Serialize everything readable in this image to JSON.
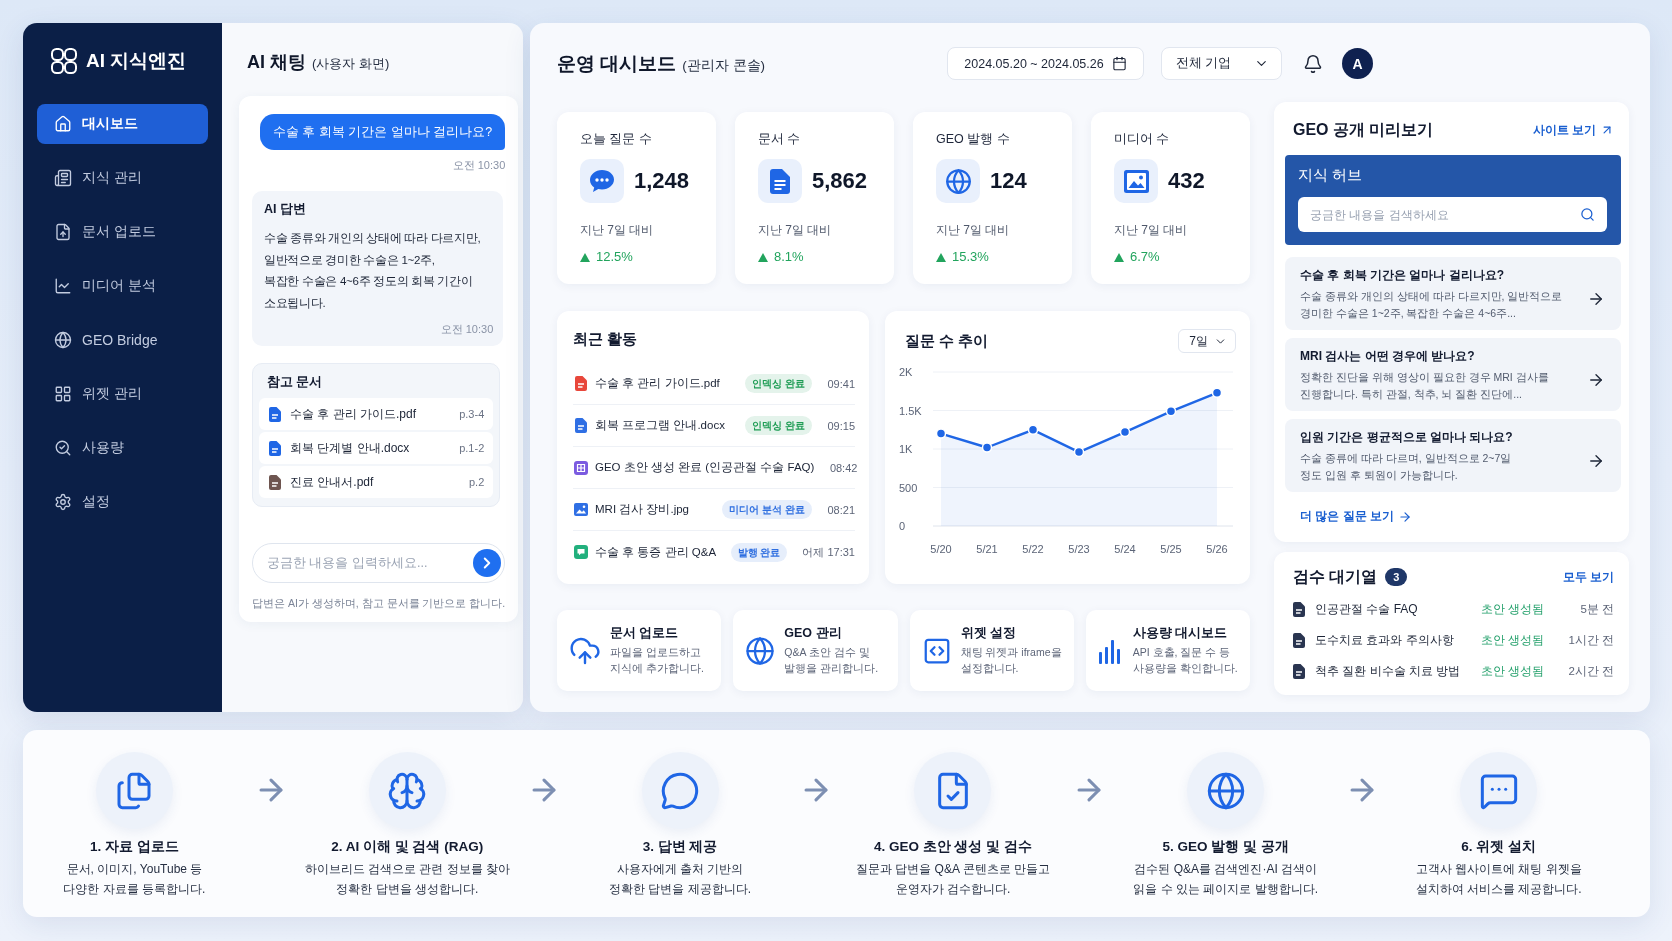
{
  "sidebar": {
    "logo": "AI 지식엔진",
    "items": [
      {
        "label": "대시보드",
        "selected": true
      },
      {
        "label": "지식 관리",
        "selected": false
      },
      {
        "label": "문서 업로드",
        "selected": false
      },
      {
        "label": "미디어 분석",
        "selected": false
      },
      {
        "label": "GEO Bridge",
        "selected": false
      },
      {
        "label": "위젯 관리",
        "selected": false
      },
      {
        "label": "사용량",
        "selected": false
      },
      {
        "label": "설정",
        "selected": false
      }
    ]
  },
  "chat": {
    "title": "AI 채팅",
    "subtitle": "(사용자 화면)",
    "user_message": {
      "text": "수술 후 회복 기간은 얼마나 걸리나요?",
      "time": "오전 10:30"
    },
    "ai_answer": {
      "heading": "AI 답변",
      "text": "수술 종류와 개인의 상태에 따라 다르지만,\n일반적으로 경미한 수술은 1~2주,\n복잡한 수술은 4~6주 정도의 회복 기간이\n소요됩니다.",
      "time": "오전 10:30"
    },
    "references": {
      "heading": "참고 문서",
      "items": [
        {
          "name": "수술 후 관리 가이드.pdf",
          "pages": "p.3-4",
          "color": "#1f66e5"
        },
        {
          "name": "회복 단계별 안내.docx",
          "pages": "p.1-2",
          "color": "#1f66e5"
        },
        {
          "name": "진료 안내서.pdf",
          "pages": "p.2",
          "color": "#6e5550"
        }
      ]
    },
    "input": {
      "placeholder": "궁금한 내용을 입력하세요..."
    },
    "footnote": "답변은 AI가 생성하며, 참고 문서를 기반으로 합니다."
  },
  "dashboard": {
    "title": "운영 대시보드",
    "subtitle": "(관리자 콘솔)",
    "date_range": "2024.05.20 ~ 2024.05.26",
    "company_filter": "전체 기업",
    "avatar": "A",
    "stats": [
      {
        "label": "오늘 질문 수",
        "value": "1,248",
        "caption": "지난 7일 대비",
        "change": "12.5%",
        "rising": true
      },
      {
        "label": "문서 수",
        "value": "5,862",
        "caption": "지난 7일 대비",
        "change": "8.1%",
        "rising": true
      },
      {
        "label": "GEO 발행 수",
        "value": "124",
        "caption": "지난 7일 대비",
        "change": "15.3%",
        "rising": true
      },
      {
        "label": "미디어 수",
        "value": "432",
        "caption": "지난 7일 대비",
        "change": "6.7%",
        "rising": true
      }
    ],
    "recent_activity": {
      "title": "최근 활동",
      "rows": [
        {
          "kind": "pdf",
          "name": "수술 후 관리 가이드.pdf",
          "badge": {
            "label": "인덱싱 완료",
            "color": "#1f9d55"
          },
          "time": "09:41"
        },
        {
          "kind": "docx",
          "name": "회복 프로그램 안내.docx",
          "badge": {
            "label": "인덱싱 완료",
            "color": "#1f9d55"
          },
          "time": "09:15"
        },
        {
          "kind": "geo",
          "name": "GEO 초안 생성 완료 (인공관절 수술 FAQ)",
          "time": "08:42"
        },
        {
          "kind": "image",
          "name": "MRI 검사 장비.jpg",
          "badge": {
            "label": "미디어 분석 완료",
            "color": "#2f6fe0"
          },
          "time": "08:21"
        },
        {
          "kind": "qa",
          "name": "수술 후 통증 관리 Q&A",
          "badge": {
            "label": "발행 완료",
            "color": "#2f6fe0"
          },
          "time": "어제 17:31"
        }
      ]
    },
    "question_trend": {
      "period": "7일",
      "chart_data": {
        "type": "area",
        "title": "질문 수 추이",
        "categories": [
          "5/20",
          "5/21",
          "5/22",
          "5/23",
          "5/24",
          "5/25",
          "5/26"
        ],
        "values": [
          1200,
          1020,
          1250,
          960,
          1220,
          1490,
          1730
        ],
        "ylim": [
          0,
          2000
        ],
        "yticks": [
          0,
          500,
          {
            "value": 1000,
            "label": "1K"
          },
          {
            "value": 1500,
            "label": "1.5K"
          },
          {
            "value": 2000,
            "label": "2K"
          }
        ],
        "grid": true
      }
    },
    "quick_links": [
      {
        "title": "문서 업로드",
        "description": "파일을 업로드하고\n지식에 추가합니다."
      },
      {
        "title": "GEO 관리",
        "description": "Q&A 초안 검수 및\n발행을 관리합니다."
      },
      {
        "title": "위젯 설정",
        "description": "채팅 위젯과 iframe을\n설정합니다."
      },
      {
        "title": "사용량 대시보드",
        "description": "API 호출, 질문 수 등\n사용량을 확인합니다."
      }
    ],
    "geo_preview": {
      "title": "GEO 공개 미리보기",
      "site_link": "사이트 보기",
      "hub_title": "지식 허브",
      "search": {
        "placeholder": "궁금한 내용을 검색하세요"
      },
      "items": [
        {
          "question": "수술 후 회복 기간은 얼마나 걸리나요?",
          "answer": "수술 종류와 개인의 상태에 따라 다르지만, 일반적으로\n경미한 수술은 1~2주, 복잡한 수술은 4~6주..."
        },
        {
          "question": "MRI 검사는 어떤 경우에 받나요?",
          "answer": "정확한 진단을 위해 영상이 필요한 경우 MRI 검사를\n진행합니다. 특히 관절, 척추, 뇌 질환 진단에..."
        },
        {
          "question": "입원 기간은 평균적으로 얼마나 되나요?",
          "answer": "수술 종류에 따라 다르며, 일반적으로 2~7일\n정도 입원 후 퇴원이 가능합니다."
        }
      ],
      "more_link": "더 많은 질문 보기"
    },
    "review_queue": {
      "title": "검수 대기열",
      "count": "3",
      "view_all": "모두 보기",
      "rows": [
        {
          "title": "인공관절 수술 FAQ",
          "status": "초안 생성됨",
          "time": "5분 전"
        },
        {
          "title": "도수치료 효과와 주의사항",
          "status": "초안 생성됨",
          "time": "1시간 전"
        },
        {
          "title": "척추 질환 비수술 치료 방법",
          "status": "초안 생성됨",
          "time": "2시간 전"
        }
      ]
    }
  },
  "workflow": {
    "steps": [
      {
        "title": "1. 자료 업로드",
        "description": "문서, 이미지, YouTube 등\n다양한 자료를 등록합니다."
      },
      {
        "title": "2. AI 이해 및 검색 (RAG)",
        "description": "하이브리드 검색으로 관련 정보를 찾아\n정확한 답변을 생성합니다."
      },
      {
        "title": "3. 답변 제공",
        "description": "사용자에게 출처 기반의\n정확한 답변을 제공합니다."
      },
      {
        "title": "4. GEO 초안 생성 및 검수",
        "description": "질문과 답변을 Q&A 콘텐츠로 만들고\n운영자가 검수합니다."
      },
      {
        "title": "5. GEO 발행 및 공개",
        "description": "검수된 Q&A를 검색엔진·AI 검색이\n읽을 수 있는 페이지로 발행합니다."
      },
      {
        "title": "6. 위젯 설치",
        "description": "고객사 웹사이트에 채팅 위젯을\n설치하여 서비스를 제공합니다."
      }
    ]
  }
}
